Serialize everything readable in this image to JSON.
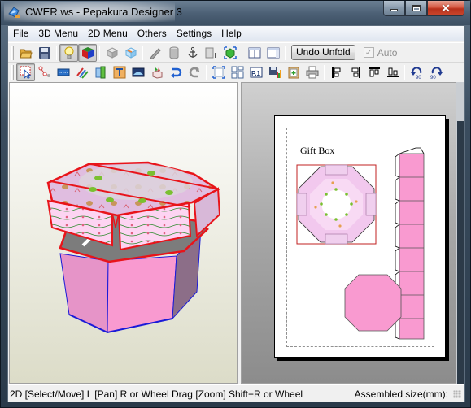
{
  "window": {
    "title": "CWER.ws - Pepakura Designer 3",
    "buttons": {
      "minimize": "minimize",
      "maximize": "maximize",
      "close": "close"
    }
  },
  "menu": [
    "File",
    "3D Menu",
    "2D Menu",
    "Others",
    "Settings",
    "Help"
  ],
  "toolbar1": {
    "buttons": [
      {
        "name": "open-icon",
        "tooltip": "Open"
      },
      {
        "name": "save-icon",
        "tooltip": "Save"
      },
      {
        "name": "lightbulb-icon",
        "tooltip": "Lighting",
        "active": true
      },
      {
        "name": "color-cube-icon",
        "tooltip": "Texture",
        "active": true
      },
      {
        "name": "box-icon",
        "tooltip": "Box"
      },
      {
        "name": "box-edge-icon",
        "tooltip": "Edge box"
      },
      {
        "name": "pencil-icon",
        "tooltip": "Pencil"
      },
      {
        "name": "cylinder-icon",
        "tooltip": "Cylinder"
      },
      {
        "name": "anchor-icon",
        "tooltip": "Anchor"
      },
      {
        "name": "panel-icon",
        "tooltip": "Panel"
      },
      {
        "name": "green-cube-select-icon",
        "tooltip": "Select"
      },
      {
        "name": "split-view-icon",
        "tooltip": "Split view"
      },
      {
        "name": "single-view-icon",
        "tooltip": "Single view"
      }
    ],
    "undo_unfold": "Undo Unfold",
    "auto_label": "Auto",
    "auto_checked": true
  },
  "toolbar2": {
    "buttons": [
      {
        "name": "select-move-icon",
        "active": true
      },
      {
        "name": "join-edge-icon"
      },
      {
        "name": "fold-line-icon"
      },
      {
        "name": "edit-color-icon"
      },
      {
        "name": "flap-icon"
      },
      {
        "name": "text-icon"
      },
      {
        "name": "image-icon"
      },
      {
        "name": "add-part-icon"
      },
      {
        "name": "redo-arrow-icon"
      },
      {
        "name": "rotate-arrow-icon"
      },
      {
        "name": "fit-page-icon"
      },
      {
        "name": "arrange-parts-icon"
      },
      {
        "name": "page-number-icon"
      },
      {
        "name": "export-icon"
      },
      {
        "name": "clipboard-icon"
      },
      {
        "name": "print-icon"
      },
      {
        "name": "align-left-icon"
      },
      {
        "name": "align-right-icon"
      },
      {
        "name": "align-top-icon"
      },
      {
        "name": "align-bottom-icon"
      },
      {
        "name": "rotate-ccw-90-icon"
      },
      {
        "name": "rotate-cw-90-icon"
      }
    ]
  },
  "view2d": {
    "page_title": "Gift Box"
  },
  "colors": {
    "box_pink": "#f99ad0",
    "lid_pink": "#f3c4e8",
    "cut_line_red": "#e8141a",
    "fold_line_blue": "#1a1ad8"
  },
  "status": {
    "hint": "2D [Select/Move] L [Pan] R or Wheel Drag [Zoom] Shift+R or Wheel",
    "assembled": "Assembled size(mm):"
  }
}
